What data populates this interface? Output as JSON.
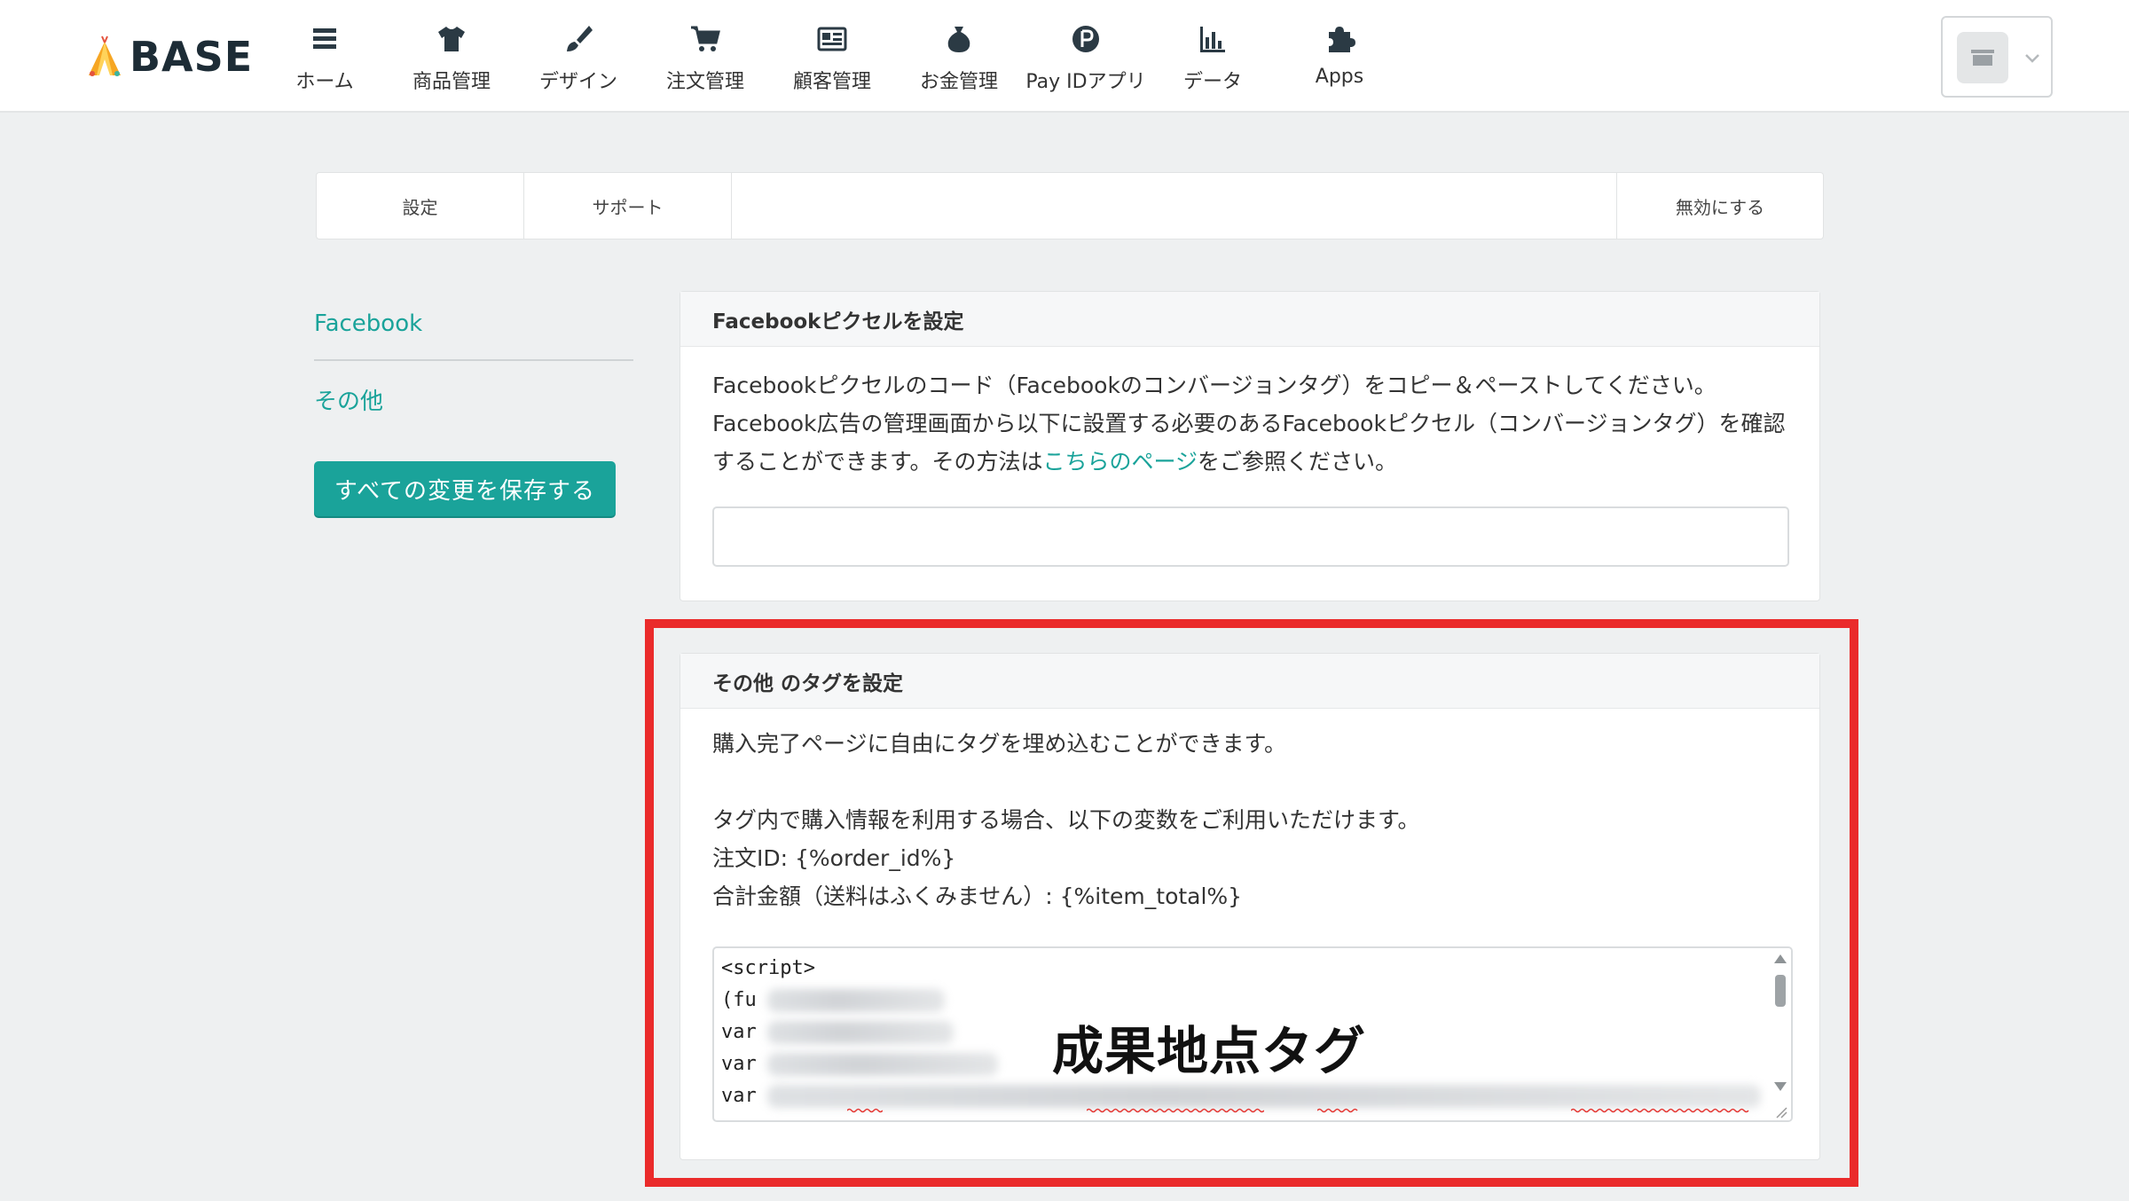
{
  "header": {
    "logo_text": "BASE",
    "nav": [
      {
        "label": "ホーム",
        "icon": "home-list-icon"
      },
      {
        "label": "商品管理",
        "icon": "tshirt-icon"
      },
      {
        "label": "デザイン",
        "icon": "brush-icon"
      },
      {
        "label": "注文管理",
        "icon": "cart-icon"
      },
      {
        "label": "顧客管理",
        "icon": "customer-card-icon"
      },
      {
        "label": "お金管理",
        "icon": "money-bag-icon"
      },
      {
        "label": "Pay IDアプリ",
        "icon": "payid-icon"
      },
      {
        "label": "データ",
        "icon": "bar-chart-icon"
      },
      {
        "label": "Apps",
        "icon": "puzzle-icon"
      }
    ],
    "store_menu_icon": "store-icon"
  },
  "tabs": {
    "settings": "設定",
    "support": "サポート",
    "disable": "無効にする"
  },
  "sidebar": {
    "facebook": "Facebook",
    "other": "その他",
    "save_button": "すべての変更を保存する"
  },
  "facebook_card": {
    "title": "Facebookピクセルを設定",
    "line1": "Facebookピクセルのコード（Facebookのコンバージョンタグ）をコピー＆ペーストしてください。",
    "line2": "Facebook広告の管理画面から以下に設置する必要のあるFacebookピクセル（コンバージョンタグ）を確認",
    "line3_prefix": "することができます。その方法は",
    "line3_link": "こちらのページ",
    "line3_suffix": "をご参照ください。",
    "textarea_value": ""
  },
  "other_card": {
    "title": "その他 のタグを設定",
    "line1": "購入完了ページに自由にタグを埋め込むことができます。",
    "line2": "タグ内で購入情報を利用する場合、以下の変数をご利用いただけます。",
    "line3": "注文ID: {%order_id%}",
    "line4": "合計金額（送料はふくみません）: {%item_total%}",
    "code_lines": [
      "<script>",
      "(fu",
      "var",
      "var",
      "var"
    ],
    "overlay_label": "成果地点タグ"
  },
  "colors": {
    "accent": "#1aa39a",
    "highlight": "#ea2b2b",
    "background": "#eef0f1"
  }
}
